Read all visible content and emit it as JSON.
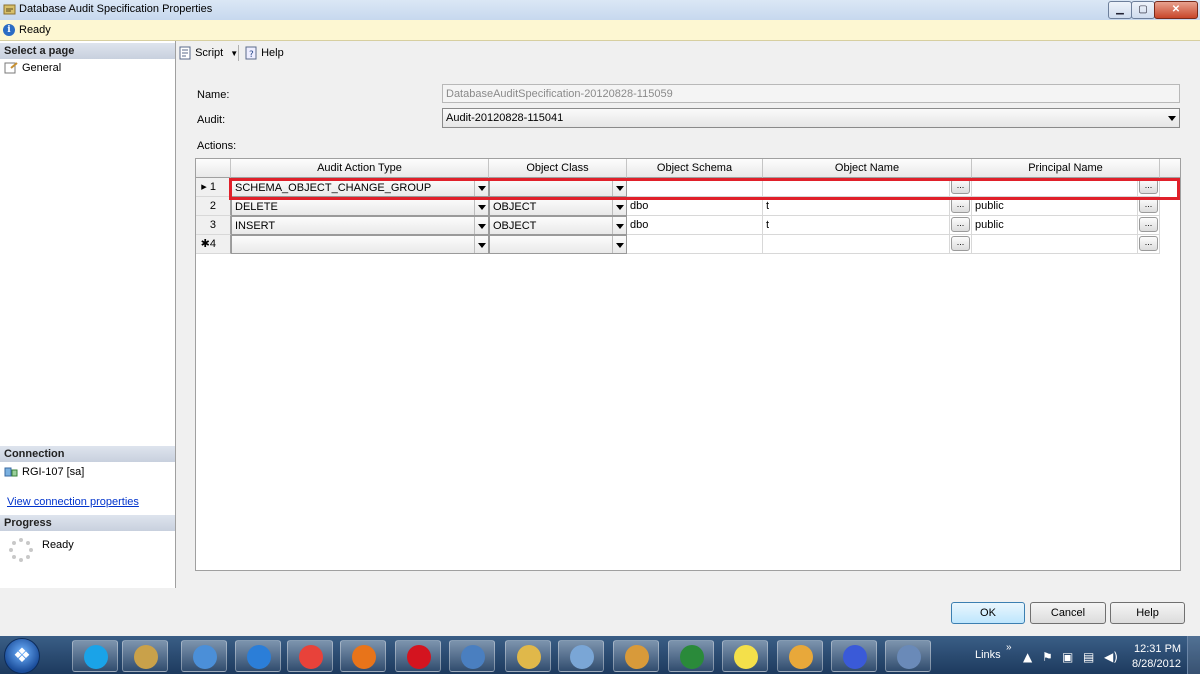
{
  "window": {
    "title": "Database Audit Specification Properties",
    "status": "Ready"
  },
  "left_panel": {
    "select_page_header": "Select a page",
    "pages": [
      "General"
    ],
    "connection_header": "Connection",
    "connection_value": "RGI-107 [sa]",
    "connection_link": "View connection properties",
    "progress_header": "Progress",
    "progress_status": "Ready"
  },
  "toolbar": {
    "script_label": "Script",
    "help_label": "Help"
  },
  "form": {
    "name_label": "Name:",
    "name_value": "DatabaseAuditSpecification-20120828-115059",
    "audit_label": "Audit:",
    "audit_value": "Audit-20120828-115041",
    "actions_label": "Actions:"
  },
  "grid": {
    "columns": [
      "Audit Action Type",
      "Object Class",
      "Object Schema",
      "Object Name",
      "Principal Name"
    ],
    "rows": [
      {
        "header": "▸ 1",
        "action": "SCHEMA_OBJECT_CHANGE_GROUP",
        "class": "",
        "schema": "",
        "name": "",
        "principal": ""
      },
      {
        "header": "2",
        "action": "DELETE",
        "class": "OBJECT",
        "schema": "dbo",
        "name": "t",
        "principal": "public"
      },
      {
        "header": "3",
        "action": "INSERT",
        "class": "OBJECT",
        "schema": "dbo",
        "name": "t",
        "principal": "public"
      },
      {
        "header": "✱4",
        "action": "",
        "class": "",
        "schema": "",
        "name": "",
        "principal": ""
      }
    ],
    "ellipsis_label": "..."
  },
  "buttons": {
    "ok": "OK",
    "cancel": "Cancel",
    "help": "Help"
  },
  "taskbar": {
    "links_label": "Links",
    "chevron": "»",
    "time": "12:31 PM",
    "date": "8/28/2012",
    "icons": [
      "skype-icon",
      "tools-icon",
      "safari-icon",
      "ie-icon",
      "chrome-icon",
      "firefox-icon",
      "opera-icon",
      "network-shield-icon",
      "folder-icon",
      "notepad-icon",
      "paint-icon",
      "media-icon",
      "bulb-icon",
      "mail-icon",
      "infinity-icon",
      "monitor-icon"
    ],
    "icon_colors": [
      "#1aa3e8",
      "#c9a14a",
      "#4b8fd8",
      "#2b7ed8",
      "#e8423a",
      "#e8741a",
      "#d4141f",
      "#4a7fc0",
      "#e0b84a",
      "#7aa6d6",
      "#d89a3a",
      "#2a8a3a",
      "#f4e04a",
      "#e8a83a",
      "#3a5ad8",
      "#6a8ab8"
    ]
  },
  "colors": {
    "highlight": "#e0202a",
    "link": "#0033cc"
  }
}
